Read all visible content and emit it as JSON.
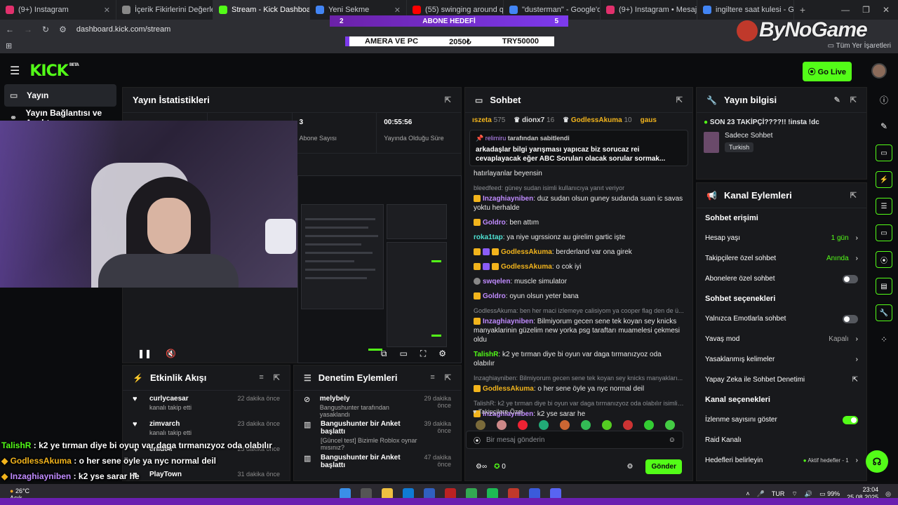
{
  "browser": {
    "tabs": [
      {
        "label": "(9+) Instagram",
        "color": "#e1306c"
      },
      {
        "label": "İçerik Fikirlerini Değerlend",
        "color": "#888888"
      },
      {
        "label": "Stream - Kick Dashboard",
        "color": "#53fc18"
      },
      {
        "label": "Yeni Sekme",
        "color": "#4285f4"
      },
      {
        "label": "(55) swinging around que",
        "color": "#ff0000"
      },
      {
        "label": "\"dusterman\" - Google'da",
        "color": "#4285f4"
      },
      {
        "label": "(9+) Instagram • Mesajlar",
        "color": "#e1306c"
      },
      {
        "label": "ingiltere saat kulesi - Goo",
        "color": "#4285f4"
      }
    ],
    "url": "dashboard.kick.com/stream",
    "all_bookmarks": "Tüm Yer İşaretleri"
  },
  "overlay": {
    "goal_left": "2",
    "goal_label": "ABONE HEDEFİ",
    "goal_right": "5",
    "banner": [
      "AMERA VE PC",
      "2050₺",
      "TRY50000"
    ],
    "watermark": "ByNoGame"
  },
  "kick": {
    "logo": "KICK",
    "beta": "BETA",
    "go_live": "Go Live"
  },
  "sidebar": {
    "items": [
      {
        "label": "Yayın"
      },
      {
        "label": "Yayın Bağlantısı ve Anahta"
      }
    ]
  },
  "stats": {
    "title": "Yayın İstatistikleri",
    "values": [
      {
        "value": "3",
        "label": "Abone Sayısı"
      },
      {
        "value": "00:55:56",
        "label": "Yayında Olduğu Süre"
      }
    ]
  },
  "activity": {
    "title": "Etkinlik Akışı",
    "items": [
      {
        "name": "curlycaesar",
        "sub": "kanalı takip etti",
        "time": "22 dakika önce"
      },
      {
        "name": "zimvarch",
        "sub": "kanalı takip etti",
        "time": "23 dakika önce"
      },
      {
        "name": "erildeu",
        "sub": "",
        "time": "23 dakika önce"
      },
      {
        "name": "PlayTown",
        "sub": "",
        "time": "31 dakika önce"
      }
    ]
  },
  "moderation": {
    "title": "Denetim Eylemleri",
    "items": [
      {
        "name": "melybely",
        "sub": "Bangushunter tarafından yasaklandı",
        "time": "29 dakika önce"
      },
      {
        "name": "Bangushunter bir Anket başlattı",
        "sub": "[Güncel test] Bizimle Roblox oynar mısınız?",
        "time": "39 dakika önce"
      },
      {
        "name": "Bangushunter bir Anket başlattı",
        "sub": "",
        "time": "47 dakika önce"
      }
    ]
  },
  "chat": {
    "title": "Sohbet",
    "top_users": [
      {
        "name": "ıszeta",
        "count": "575",
        "color": "#f2b41c"
      },
      {
        "name": "dionx7",
        "count": "16",
        "color": "#dddddd"
      },
      {
        "name": "GodlessAkuma",
        "count": "10",
        "color": "#f2b41c"
      },
      {
        "name": "gaus",
        "count": "",
        "color": "#f2b41c"
      }
    ],
    "pinned_by": "relimiru",
    "pinned_by_suffix": "tarafından sabitlendi",
    "pinned_msg": "arkadaşlar bilgi yarışması yapıcaz biz sorucaz rei cevaplayacak eğer ABC Soruları olacak sorular sormak...",
    "messages": [
      {
        "reply": "",
        "user": "",
        "color": "#ffffff",
        "text": "hatırlayanlar beyensin"
      },
      {
        "reply": "bleedfeed: güney sudan isimli kullanıcıya yanıt veriyor",
        "user": "Inzaghiayniben",
        "color": "#c08bff",
        "text": "duz sudan olsun guney sudanda suan ic savas yoktu herhalde"
      },
      {
        "reply": "",
        "user": "Goldro",
        "color": "#c08bff",
        "text": "ben attım"
      },
      {
        "reply": "",
        "user": "roka1tap",
        "color": "#4ee0d2",
        "text": "ya niye ugrssionz au girelim gartic işte"
      },
      {
        "reply": "",
        "user": "GodlessAkuma",
        "color": "#f2b41c",
        "text": "berderland var ona girek"
      },
      {
        "reply": "",
        "user": "GodlessAkuma",
        "color": "#f2b41c",
        "text": "o cok iyi"
      },
      {
        "reply": "",
        "user": "swqelen",
        "color": "#c08bff",
        "text": "muscle simulator"
      },
      {
        "reply": "",
        "user": "Goldro",
        "color": "#c08bff",
        "text": "oyun olsun yeter bana"
      },
      {
        "reply": "GodlessAkuma: ben her maci izlemeye calisiyom ya cooper flag den de ü...",
        "user": "Inzaghiayniben",
        "color": "#c08bff",
        "text": "Bilmiyorum gecen sene tek koyan sey knicks manyaklarinin güzelim new yorka psg taraftarı muamelesi çekmesi oldu"
      },
      {
        "reply": "",
        "user": "TalishR",
        "color": "#53fc18",
        "text": "k2 ye tırman diye bi oyun var daga tırmanızyoz oda olabılır"
      },
      {
        "reply": "Inzaghiayniben: Bilmiyorum gecen sene tek koyan sey knicks manyakları...",
        "user": "GodlessAkuma",
        "color": "#f2b41c",
        "text": "o her sene öyle ya nyc normal deil"
      },
      {
        "reply": "TalishR: k2 ye tırman diye bi oyun var daga tırmanızyoz oda olabılır isimli ...",
        "user": "Inzaghiayniben",
        "color": "#c08bff",
        "text": "k2 yse sarar he"
      }
    ],
    "followers_only": "Takipçilere Özel",
    "input_placeholder": "Bir mesaj gönderin",
    "points": "0",
    "send": "Gönder"
  },
  "stream_info": {
    "title": "Yayın bilgisi",
    "stream_title": "SON 23 TAKİPÇİ????!! !insta !dc",
    "category": "Sadece Sohbet",
    "language": "Turkish"
  },
  "channel_actions": {
    "title": "Kanal Eylemleri",
    "chat_access": "Sohbet erişimi",
    "account_age": "Hesap yaşı",
    "account_age_value": "1 gün",
    "followers_chat": "Takipçilere özel sohbet",
    "followers_chat_value": "Anında",
    "subs_chat": "Abonelere özel sohbet",
    "chat_options": "Sohbet seçenekleri",
    "emote_only": "Yalnızca Emotlarla sohbet",
    "slow_mode": "Yavaş mod",
    "slow_mode_value": "Kapalı",
    "banned_words": "Yasaklanmış kelimeler",
    "ai_moderation": "Yapay Zeka ile Sohbet Denetimi",
    "channel_options": "Kanal seçenekleri",
    "show_viewers": "İzlenme sayısını göster",
    "raid": "Raid Kanalı",
    "goals": "Hedefleri belirleyin",
    "goals_value": "Aktif hedefler - 1"
  },
  "overlay_chat": [
    {
      "user": "TalishR",
      "color": "#53fc18",
      "text": " : k2 ye tırman diye bi oyun var daga tırmanızyoz oda olabılır"
    },
    {
      "user": "GodlessAkuma",
      "color": "#f2b41c",
      "text": " : o her sene öyle ya nyc normal deil"
    },
    {
      "user": "Inzaghiayniben",
      "color": "#c08bff",
      "text": " : k2 yse sarar he"
    }
  ],
  "taskbar": {
    "temp": "26°C",
    "weather": "Açık",
    "lang": "TUR",
    "battery": "99%",
    "time": "23:04",
    "date": "25.08.2025"
  }
}
